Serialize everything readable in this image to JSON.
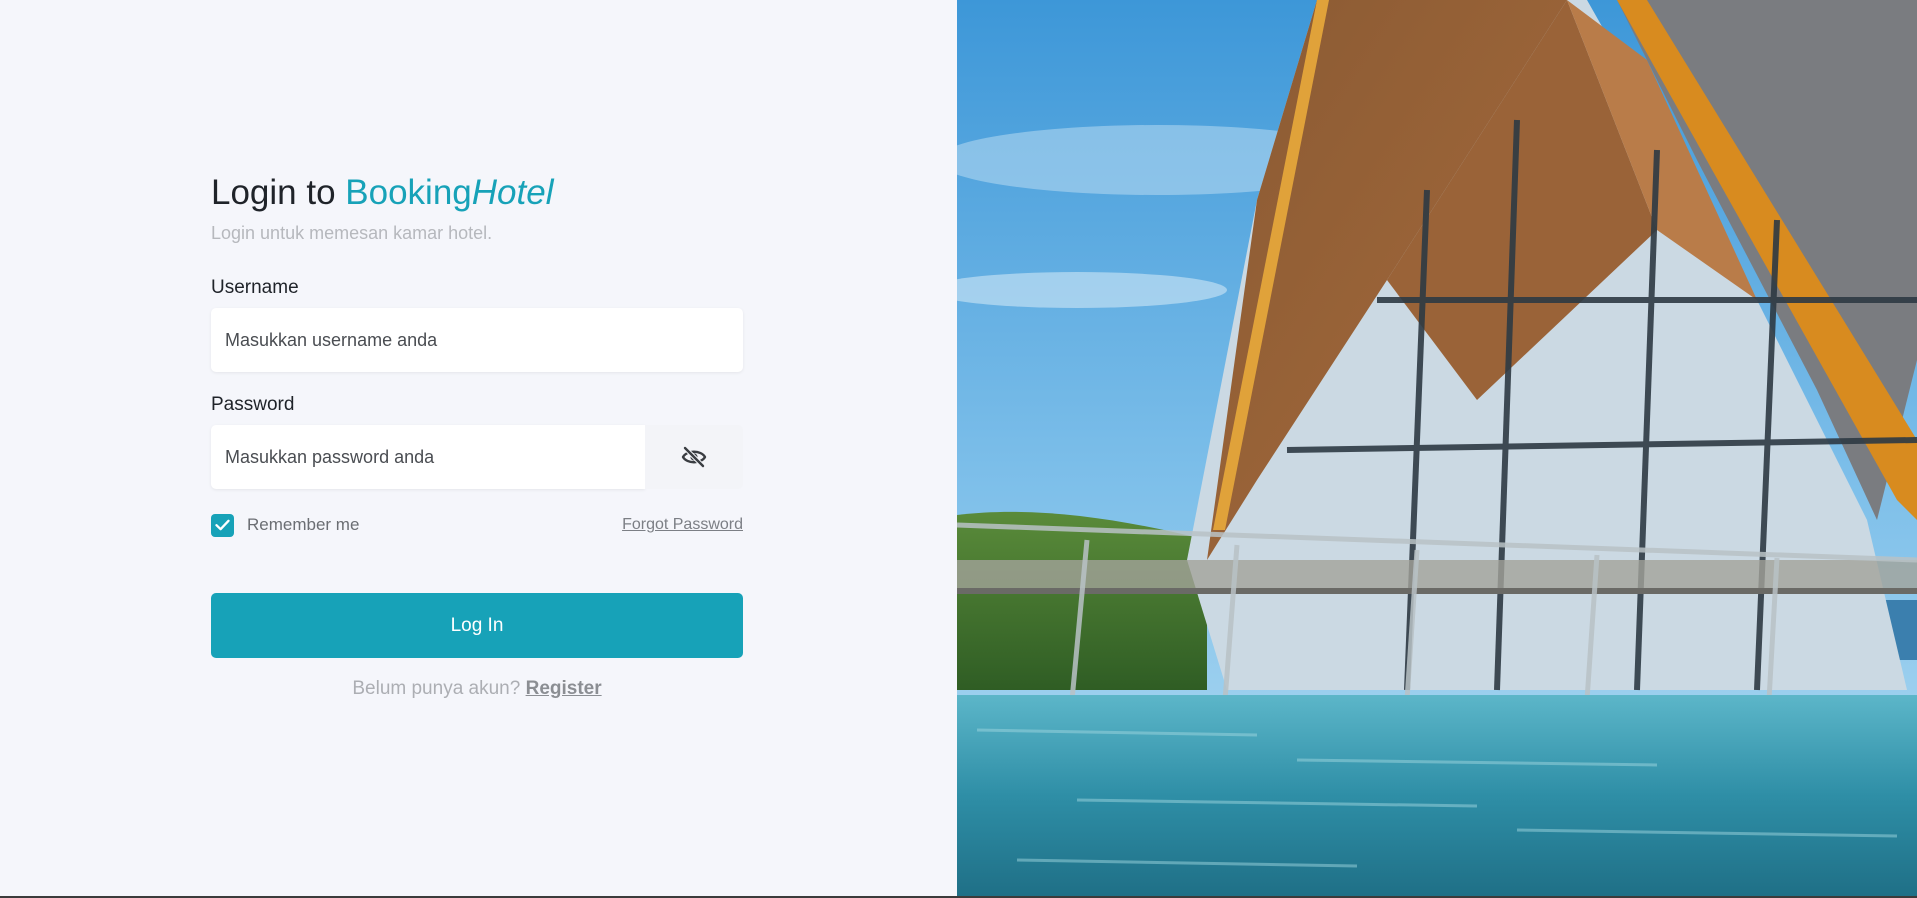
{
  "login": {
    "title_prefix": "Login to ",
    "brand_part1": "Booking",
    "brand_part2": "Hotel",
    "subtitle": "Login untuk memesan kamar hotel.",
    "username_label": "Username",
    "username_placeholder": "Masukkan username anda",
    "username_value": "",
    "password_label": "Password",
    "password_placeholder": "Masukkan password anda",
    "password_value": "",
    "toggle_password_icon": "eye-slash-icon",
    "remember_label": "Remember me",
    "remember_checked": true,
    "forgot_label": "Forgot Password",
    "login_button": "Log In",
    "register_prompt": "Belum punya akun? ",
    "register_link": "Register"
  },
  "hero_image": {
    "subject": "hotel-building-with-pool-photo"
  },
  "colors": {
    "accent": "#17a2b8",
    "left_background": "#f5f6fb",
    "title_text": "#1f2329",
    "subtitle_text": "#b6b8bd"
  }
}
